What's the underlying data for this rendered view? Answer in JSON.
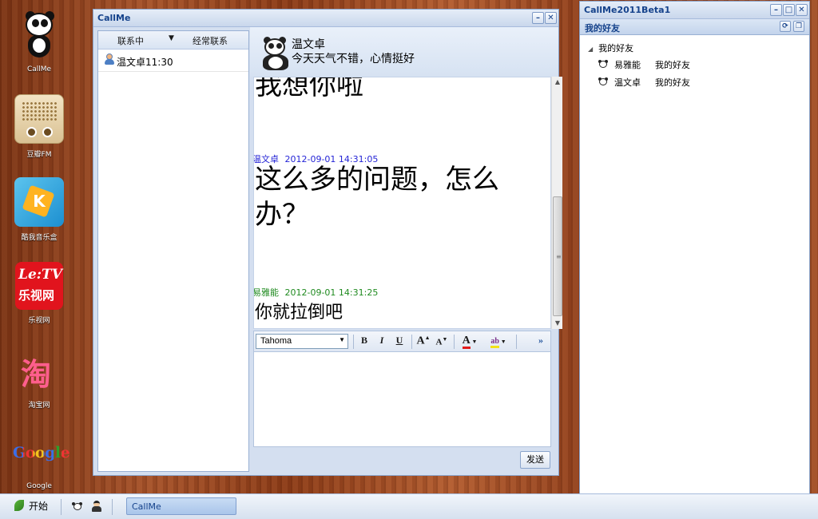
{
  "desktop": {
    "icons": [
      {
        "label": "CallMe",
        "icon": "panda-icon"
      },
      {
        "label": "豆瓣FM",
        "icon": "radio-icon"
      },
      {
        "label": "酷我音乐盒",
        "icon": "kuwo-icon"
      },
      {
        "label": "乐视网",
        "icon": "letv-icon",
        "logo_text_1": "Le:TV",
        "logo_text_2": "乐视网"
      },
      {
        "label": "淘宝网",
        "icon": "taobao-icon",
        "logo_text": "淘"
      },
      {
        "label": "Google",
        "icon": "google-icon",
        "logo_text": "Google"
      }
    ]
  },
  "chat_window": {
    "title": "CallMe",
    "contacts_header": {
      "tab_active": "联系中",
      "tab_other": "经常联系"
    },
    "contacts": [
      {
        "name": "温文卓11:30",
        "icon": "user-icon"
      }
    ],
    "peer": {
      "name": "温文卓",
      "status": "今天天气不错，心情挺好"
    },
    "messages": [
      {
        "text": "我想你啦"
      },
      {
        "sender": "温文卓",
        "time": "2012-09-01 14:31:05",
        "text": "这么多的问题，怎么办？"
      },
      {
        "sender": "易雅能",
        "time": "2012-09-01 14:31:25",
        "text": "你就拉倒吧"
      }
    ],
    "toolbar": {
      "font": "Tahoma",
      "bold": "B",
      "italic": "I",
      "underline": "U",
      "grow": "A",
      "shrink": "A",
      "font_color": "A",
      "highlight": "ab",
      "more": "»"
    },
    "compose_value": "",
    "send_label": "发送"
  },
  "friends_window": {
    "title": "CallMe2011Beta1",
    "panel_title": "我的好友",
    "group": "我的好友",
    "friends": [
      {
        "name": "易雅能",
        "group": "我的好友"
      },
      {
        "name": "温文卓",
        "group": "我的好友"
      }
    ]
  },
  "taskbar": {
    "start_label": "开始",
    "tasks": [
      {
        "label": "CallMe"
      }
    ]
  },
  "colors": {
    "title_text": "#15428b",
    "meta_blue": "#2424d6",
    "meta_green": "#1f8a1f",
    "window_frame": "#d4dff0"
  }
}
